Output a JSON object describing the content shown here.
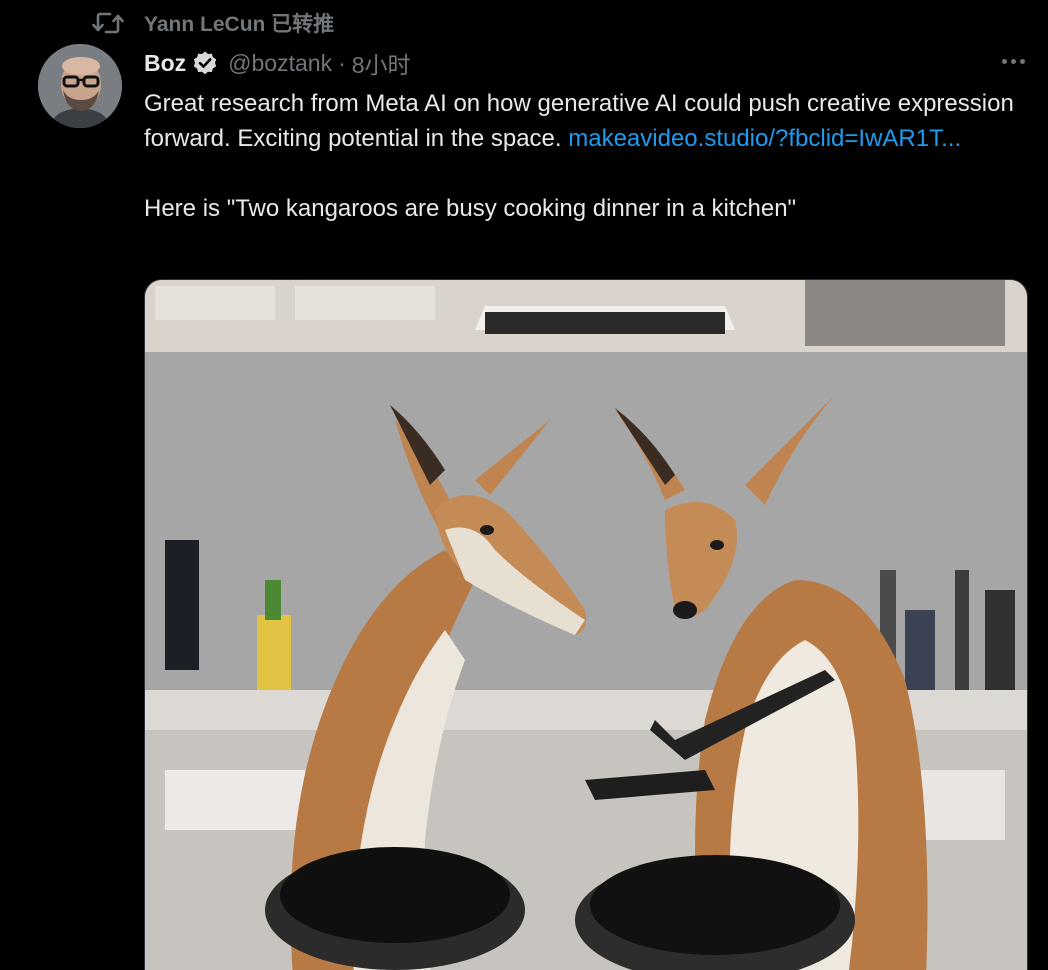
{
  "retweet": {
    "label": "Yann LeCun 已转推",
    "icon": "retweet-icon"
  },
  "author": {
    "name": "Boz",
    "handle": "@boztank",
    "separator": "·",
    "time": "8小时",
    "verified": true,
    "verified_color": "#d9d9d9"
  },
  "tweet": {
    "text_line1": "Great research from Meta AI on how generative AI could push creative expression forward. Exciting potential in the space. ",
    "link": "makeavideo.studio/?fbclid=IwAR1T...",
    "text_line2": "Here is \"Two kangaroos are busy cooking dinner in a kitchen\""
  },
  "colors": {
    "background": "#000000",
    "text": "#e7e9ea",
    "secondary": "#71767b",
    "link": "#1d9bf0"
  },
  "icons": [
    "retweet-icon",
    "verified-icon",
    "more-icon"
  ]
}
